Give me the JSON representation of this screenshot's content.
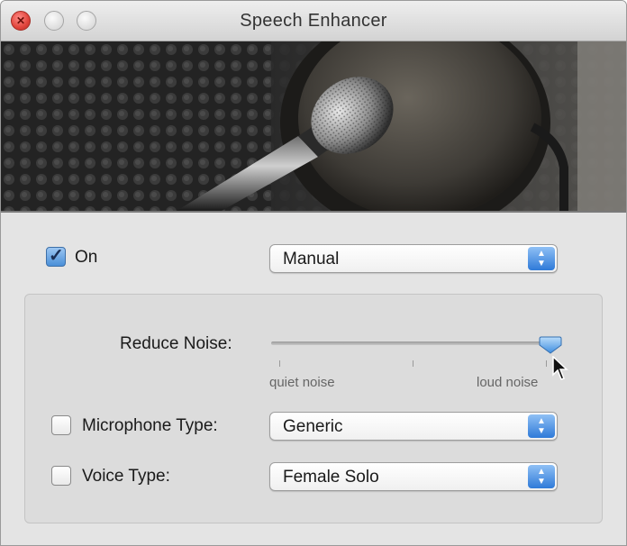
{
  "window": {
    "title": "Speech Enhancer"
  },
  "controls": {
    "on_label": "On",
    "on_checked": true,
    "mode": "Manual"
  },
  "settings": {
    "reduce_noise_label": "Reduce Noise:",
    "reduce_noise_level": 0.98,
    "slider_min_label": "quiet noise",
    "slider_max_label": "loud noise",
    "microphone_type_label": "Microphone Type:",
    "microphone_type_checked": false,
    "microphone_type_value": "Generic",
    "voice_type_label": "Voice Type:",
    "voice_type_checked": false,
    "voice_type_value": "Female Solo"
  },
  "colors": {
    "accent_blue": "#3b82d8",
    "close_red": "#e0443b"
  },
  "icons": [
    "close-icon",
    "minimize-icon",
    "zoom-icon",
    "checkmark-icon",
    "popup-arrows-icon",
    "mouse-cursor-icon",
    "microphone-image"
  ]
}
